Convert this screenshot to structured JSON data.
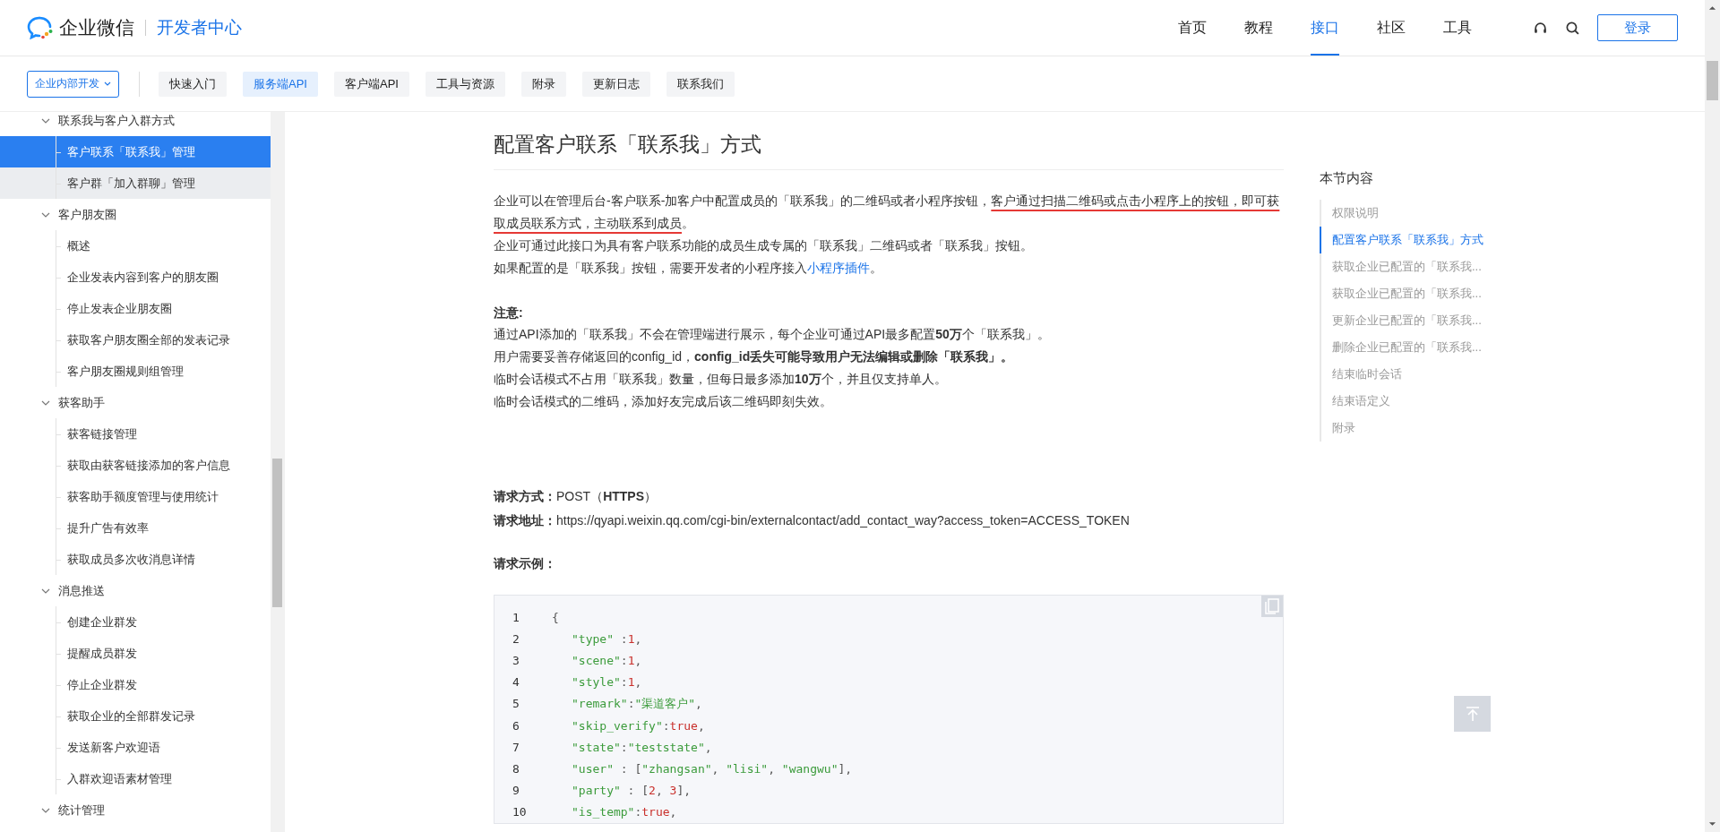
{
  "header": {
    "logo_text": "企业微信",
    "subtitle": "开发者中心",
    "nav": [
      {
        "label": "首页",
        "selected": false
      },
      {
        "label": "教程",
        "selected": false
      },
      {
        "label": "接口",
        "selected": true
      },
      {
        "label": "社区",
        "selected": false
      },
      {
        "label": "工具",
        "selected": false
      }
    ],
    "login_button": "登录"
  },
  "subnav": {
    "dropdown": "企业内部开发",
    "tabs": [
      {
        "label": "快速入门",
        "selected": false
      },
      {
        "label": "服务端API",
        "selected": true
      },
      {
        "label": "客户端API",
        "selected": false
      },
      {
        "label": "工具与资源",
        "selected": false
      },
      {
        "label": "附录",
        "selected": false
      },
      {
        "label": "更新日志",
        "selected": false
      },
      {
        "label": "联系我们",
        "selected": false
      }
    ]
  },
  "sidebar": {
    "groups": [
      {
        "label": "联系我与客户入群方式",
        "expanded": true,
        "children": [
          {
            "label": "客户联系「联系我」管理",
            "selected": true,
            "highlighted": false
          },
          {
            "label": "客户群「加入群聊」管理",
            "selected": false,
            "highlighted": true
          }
        ]
      },
      {
        "label": "客户朋友圈",
        "expanded": true,
        "children": [
          {
            "label": "概述",
            "selected": false,
            "highlighted": false
          },
          {
            "label": "企业发表内容到客户的朋友圈",
            "selected": false,
            "highlighted": false
          },
          {
            "label": "停止发表企业朋友圈",
            "selected": false,
            "highlighted": false
          },
          {
            "label": "获取客户朋友圈全部的发表记录",
            "selected": false,
            "highlighted": false
          },
          {
            "label": "客户朋友圈规则组管理",
            "selected": false,
            "highlighted": false
          }
        ]
      },
      {
        "label": "获客助手",
        "expanded": true,
        "children": [
          {
            "label": "获客链接管理",
            "selected": false,
            "highlighted": false
          },
          {
            "label": "获取由获客链接添加的客户信息",
            "selected": false,
            "highlighted": false
          },
          {
            "label": "获客助手额度管理与使用统计",
            "selected": false,
            "highlighted": false
          },
          {
            "label": "提升广告有效率",
            "selected": false,
            "highlighted": false
          },
          {
            "label": "获取成员多次收消息详情",
            "selected": false,
            "highlighted": false
          }
        ]
      },
      {
        "label": "消息推送",
        "expanded": true,
        "children": [
          {
            "label": "创建企业群发",
            "selected": false,
            "highlighted": false
          },
          {
            "label": "提醒成员群发",
            "selected": false,
            "highlighted": false
          },
          {
            "label": "停止企业群发",
            "selected": false,
            "highlighted": false
          },
          {
            "label": "获取企业的全部群发记录",
            "selected": false,
            "highlighted": false
          },
          {
            "label": "发送新客户欢迎语",
            "selected": false,
            "highlighted": false
          },
          {
            "label": "入群欢迎语素材管理",
            "selected": false,
            "highlighted": false
          }
        ]
      },
      {
        "label": "统计管理",
        "expanded": true
      }
    ]
  },
  "article": {
    "title": "配置客户联系「联系我」方式",
    "intro": [
      {
        "parts": [
          {
            "kind": "plain",
            "text": "企业可以在管理后台-客户联系-加客户中配置成员的「联系我」的二维码或者小程序按钮，"
          },
          {
            "kind": "marked",
            "text": "客户通过扫描二维码或点击小程序上的按钮，即可获取成员联系方式，主动联系到成员"
          },
          {
            "kind": "plain",
            "text": "。"
          }
        ]
      },
      {
        "parts": [
          {
            "kind": "plain",
            "text": "企业可通过此接口为具有客户联系功能的成员生成专属的「联系我」二维码或者「联系我」按钮。"
          }
        ]
      },
      {
        "parts": [
          {
            "kind": "plain",
            "text": "如果配置的是「联系我」按钮，需要开发者的小程序接入"
          },
          {
            "kind": "link",
            "text": "小程序插件"
          },
          {
            "kind": "plain",
            "text": "。"
          }
        ]
      }
    ],
    "note_title": "注意:",
    "notes": [
      "通过API添加的「联系我」不会在管理端进行展示，每个企业可通过API最多配置**50万**个「联系我」。",
      "用户需要妥善存储返回的config_id，**config_id丢失可能导致用户无法编辑或删除「联系我」。**",
      "临时会话模式不占用「联系我」数量，但每日最多添加**10万**个，并且仅支持单人。",
      "临时会话模式的二维码，添加好友完成后该二维码即刻失效。"
    ],
    "method_label": "请求方式：",
    "method": "POST（**HTTPS**）",
    "url_label": "请求地址：",
    "url": "https://qyapi.weixin.qq.com/cgi-bin/externalcontact/add_contact_way?access_token=ACCESS_TOKEN",
    "example_label": "请求示例：",
    "code": {
      "open": {
        "number": "1",
        "tokens": [
          {
            "kind": "punct",
            "text": "{"
          }
        ]
      },
      "entries": [
        {
          "number": "2",
          "tokens": [
            {
              "kind": "key",
              "text": "\"type\""
            },
            {
              "kind": "punct",
              "text": " :"
            },
            {
              "kind": "num",
              "text": "1"
            },
            {
              "kind": "punct",
              "text": ","
            }
          ]
        },
        {
          "number": "3",
          "tokens": [
            {
              "kind": "key",
              "text": "\"scene\""
            },
            {
              "kind": "punct",
              "text": ":"
            },
            {
              "kind": "num",
              "text": "1"
            },
            {
              "kind": "punct",
              "text": ","
            }
          ]
        },
        {
          "number": "4",
          "tokens": [
            {
              "kind": "key",
              "text": "\"style\""
            },
            {
              "kind": "punct",
              "text": ":"
            },
            {
              "kind": "num",
              "text": "1"
            },
            {
              "kind": "punct",
              "text": ","
            }
          ]
        },
        {
          "number": "5",
          "tokens": [
            {
              "kind": "key",
              "text": "\"remark\""
            },
            {
              "kind": "punct",
              "text": ":"
            },
            {
              "kind": "str",
              "text": "\"渠道客户\""
            },
            {
              "kind": "punct",
              "text": ","
            }
          ]
        },
        {
          "number": "6",
          "tokens": [
            {
              "kind": "key",
              "text": "\"skip_verify\""
            },
            {
              "kind": "punct",
              "text": ":"
            },
            {
              "kind": "bool",
              "text": "true"
            },
            {
              "kind": "punct",
              "text": ","
            }
          ]
        },
        {
          "number": "7",
          "tokens": [
            {
              "kind": "key",
              "text": "\"state\""
            },
            {
              "kind": "punct",
              "text": ":"
            },
            {
              "kind": "str",
              "text": "\"teststate\""
            },
            {
              "kind": "punct",
              "text": ","
            }
          ]
        },
        {
          "number": "8",
          "tokens": [
            {
              "kind": "key",
              "text": "\"user\""
            },
            {
              "kind": "punct",
              "text": " : ["
            },
            {
              "kind": "str",
              "text": "\"zhangsan\""
            },
            {
              "kind": "punct",
              "text": ", "
            },
            {
              "kind": "str",
              "text": "\"lisi\""
            },
            {
              "kind": "punct",
              "text": ", "
            },
            {
              "kind": "str",
              "text": "\"wangwu\""
            },
            {
              "kind": "punct",
              "text": "],"
            }
          ]
        },
        {
          "number": "9",
          "tokens": [
            {
              "kind": "key",
              "text": "\"party\""
            },
            {
              "kind": "punct",
              "text": " : ["
            },
            {
              "kind": "num",
              "text": "2"
            },
            {
              "kind": "punct",
              "text": ", "
            },
            {
              "kind": "num",
              "text": "3"
            },
            {
              "kind": "punct",
              "text": "],"
            }
          ]
        },
        {
          "number": "10",
          "tokens": [
            {
              "kind": "key",
              "text": "\"is_temp\""
            },
            {
              "kind": "punct",
              "text": ":"
            },
            {
              "kind": "bool",
              "text": "true"
            },
            {
              "kind": "punct",
              "text": ","
            }
          ]
        }
      ]
    }
  },
  "toc": {
    "title": "本节内容",
    "items": [
      {
        "label": "权限说明",
        "selected": false
      },
      {
        "label": "配置客户联系「联系我」方式",
        "selected": true
      },
      {
        "label": "获取企业已配置的「联系我...",
        "selected": false
      },
      {
        "label": "获取企业已配置的「联系我...",
        "selected": false
      },
      {
        "label": "更新企业已配置的「联系我...",
        "selected": false
      },
      {
        "label": "删除企业已配置的「联系我...",
        "selected": false
      },
      {
        "label": "结束临时会话",
        "selected": false
      },
      {
        "label": "结束语定义",
        "selected": false
      },
      {
        "label": "附录",
        "selected": false
      }
    ]
  }
}
